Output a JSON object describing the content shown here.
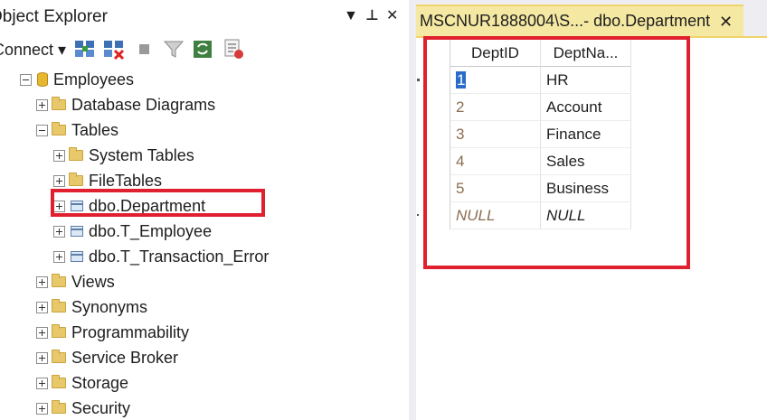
{
  "object_explorer": {
    "title": "Object Explorer",
    "title_buttons": {
      "dropdown": "▼",
      "pin": "⊥",
      "close": "✕"
    },
    "toolbar": {
      "connect_label": "Connect ▾",
      "icons": [
        "connect-object-explorer-icon",
        "disconnect-icon",
        "stop-icon",
        "filter-icon",
        "refresh-icon",
        "activity-monitor-icon"
      ]
    },
    "tree": [
      {
        "label": "Employees",
        "icon": "database-icon",
        "expander": "minus"
      },
      {
        "label": "Database Diagrams",
        "icon": "folder-icon",
        "expander": "plus"
      },
      {
        "label": "Tables",
        "icon": "folder-icon",
        "expander": "minus"
      },
      {
        "label": "System Tables",
        "icon": "folder-icon",
        "expander": "plus"
      },
      {
        "label": "FileTables",
        "icon": "folder-icon",
        "expander": "plus"
      },
      {
        "label": "dbo.Department",
        "icon": "table-icon",
        "expander": "plus"
      },
      {
        "label": "dbo.T_Employee",
        "icon": "table-icon",
        "expander": "plus"
      },
      {
        "label": "dbo.T_Transaction_Error",
        "icon": "table-icon",
        "expander": "plus"
      },
      {
        "label": "Views",
        "icon": "folder-icon",
        "expander": "plus"
      },
      {
        "label": "Synonyms",
        "icon": "folder-icon",
        "expander": "plus"
      },
      {
        "label": "Programmability",
        "icon": "folder-icon",
        "expander": "plus"
      },
      {
        "label": "Service Broker",
        "icon": "folder-icon",
        "expander": "plus"
      },
      {
        "label": "Storage",
        "icon": "folder-icon",
        "expander": "plus"
      },
      {
        "label": "Security",
        "icon": "folder-icon",
        "expander": "plus"
      }
    ]
  },
  "document": {
    "tab_title": "MSCNUR1888004\\S...- dbo.Department",
    "tab_close": "✕",
    "grid": {
      "columns": [
        "DeptID",
        "DeptNa..."
      ],
      "rows": [
        [
          "1",
          "HR"
        ],
        [
          "2",
          "Account"
        ],
        [
          "3",
          "Finance"
        ],
        [
          "4",
          "Sales"
        ],
        [
          "5",
          "Business"
        ],
        [
          "NULL",
          "NULL"
        ]
      ]
    }
  },
  "colors": {
    "highlight_border": "#e0202e",
    "active_tab": "#f5e8a3",
    "selected_cell": "#2a6cc9"
  }
}
